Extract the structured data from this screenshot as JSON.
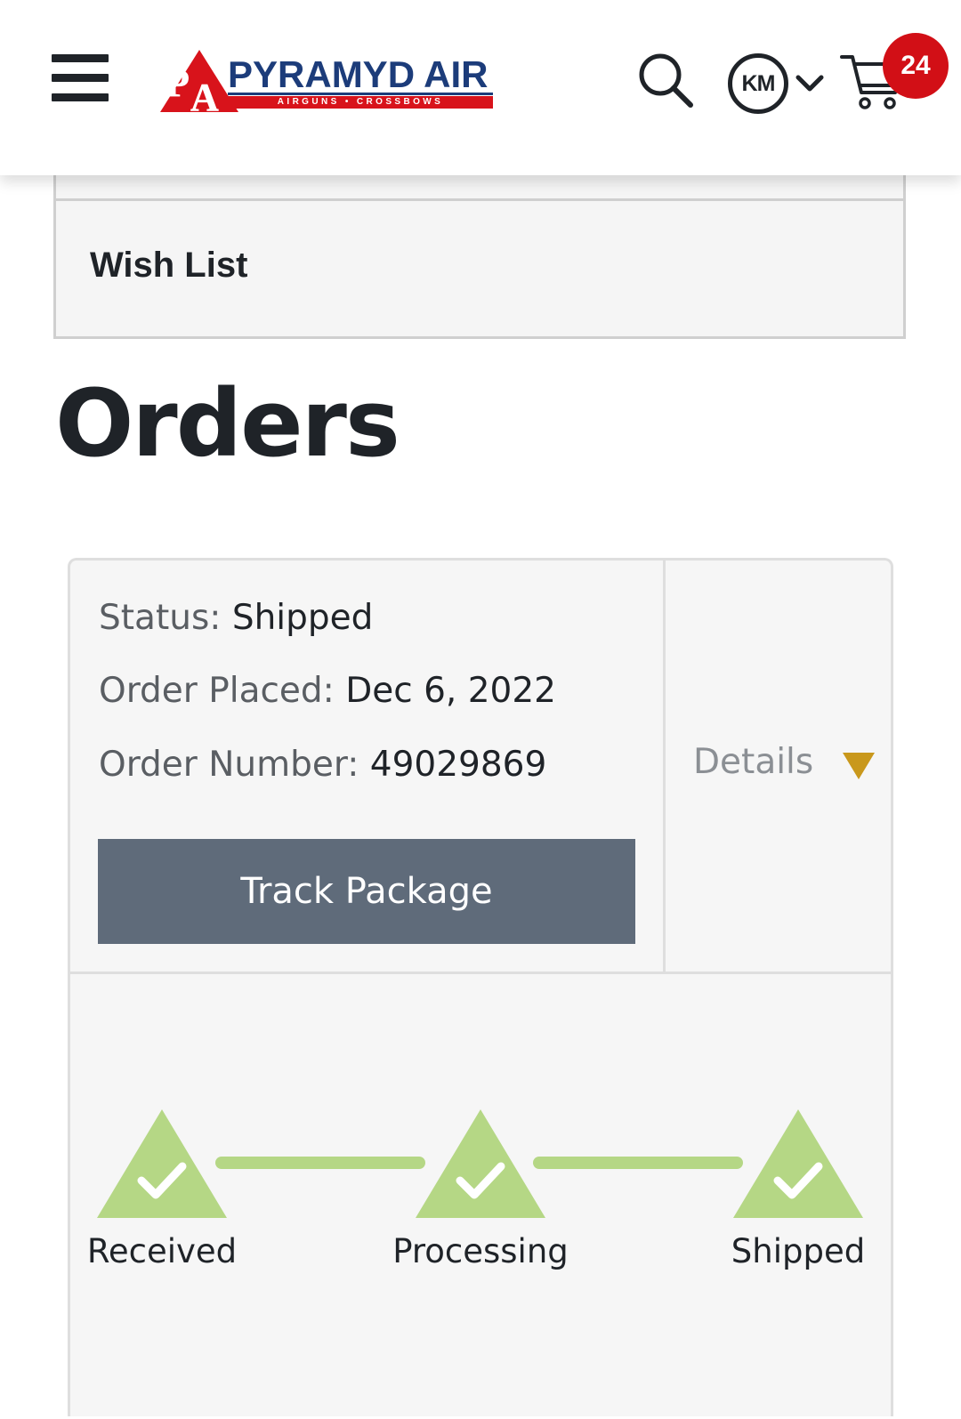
{
  "header": {
    "logo": {
      "monogram": "PA",
      "brand": "PYRAMYD AIR",
      "tagline": "AIRGUNS • CROSSBOWS"
    },
    "account_initials": "KM",
    "cart_count": "24"
  },
  "account_menu": {
    "wish_list": "Wish List"
  },
  "page_title": "Orders",
  "order": {
    "status_label": "Status:",
    "status_value": "Shipped",
    "placed_label": "Order Placed:",
    "placed_value": "Dec 6, 2022",
    "number_label": "Order Number:",
    "number_value": "49029869",
    "track_button": "Track Package",
    "details_label": "Details",
    "steps": [
      {
        "label": "Received",
        "complete": true
      },
      {
        "label": "Processing",
        "complete": true
      },
      {
        "label": "Shipped",
        "complete": true
      }
    ]
  },
  "colors": {
    "brand_blue": "#1c3c7a",
    "brand_red": "#d8131b",
    "badge_red": "#d20f16",
    "step_complete": "#b5d785",
    "details_arrow": "#c9981c",
    "track_button_bg": "#5f6b7a"
  },
  "icons": {
    "menu": "hamburger-icon",
    "search": "search-icon",
    "account_chevron": "chevron-down-icon",
    "cart": "cart-icon",
    "details": "triangle-down-icon",
    "step": "check-triangle-icon"
  }
}
